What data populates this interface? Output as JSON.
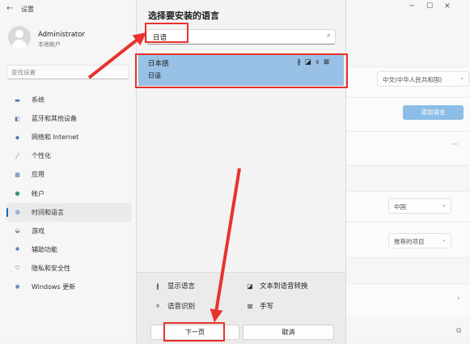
{
  "window": {
    "app_title": "设置",
    "controls": [
      "─",
      "☐",
      "✕"
    ]
  },
  "profile": {
    "name": "Administrator",
    "type": "本地帐户"
  },
  "sidebar": {
    "search_placeholder": "查找设置",
    "items": [
      {
        "label": "系统",
        "icon": "system-icon"
      },
      {
        "label": "蓝牙和其他设备",
        "icon": "bluetooth-icon"
      },
      {
        "label": "网络和 Internet",
        "icon": "wifi-icon"
      },
      {
        "label": "个性化",
        "icon": "brush-icon"
      },
      {
        "label": "应用",
        "icon": "apps-icon"
      },
      {
        "label": "帐户",
        "icon": "account-icon"
      },
      {
        "label": "时间和语言",
        "icon": "globe-icon",
        "active": true
      },
      {
        "label": "游戏",
        "icon": "game-icon"
      },
      {
        "label": "辅助功能",
        "icon": "accessibility-icon"
      },
      {
        "label": "隐私和安全性",
        "icon": "shield-icon"
      },
      {
        "label": "Windows 更新",
        "icon": "update-icon"
      }
    ]
  },
  "right_panel": {
    "display_language": "中文(中华人民共和国)",
    "add_language_button": "添加语言",
    "region": "中国",
    "regional_format": "推荐的项目"
  },
  "dialog": {
    "title": "选择要安装的语言",
    "search_value": "日语",
    "result": {
      "name": "日本語",
      "native": "日语"
    },
    "features": {
      "display_language": "显示语言",
      "text_to_speech": "文本到语音转换",
      "speech_recognition": "语音识别",
      "handwriting": "手写"
    },
    "next_button": "下一页",
    "cancel_button": "取消"
  },
  "colors": {
    "highlight": "#e8322e",
    "selection": "#99c1e6",
    "accent": "#0067c0",
    "add_button": "#8cbde6"
  }
}
